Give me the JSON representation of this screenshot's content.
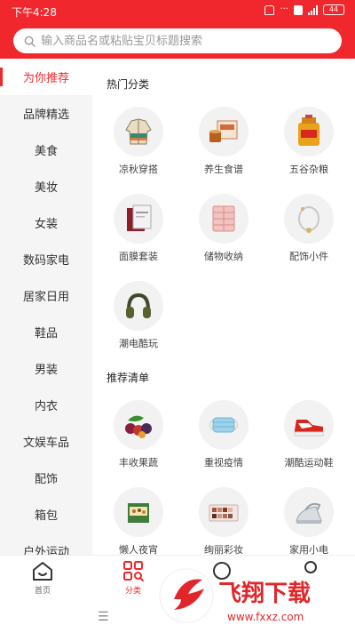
{
  "status_bar": {
    "time": "下午4:28",
    "battery": "44"
  },
  "search": {
    "placeholder": "输入商品名或粘贴宝贝标题搜索"
  },
  "sidebar": {
    "items": [
      {
        "label": "为你推荐",
        "active": true
      },
      {
        "label": "品牌精选"
      },
      {
        "label": "美食"
      },
      {
        "label": "美妆"
      },
      {
        "label": "女装"
      },
      {
        "label": "数码家电"
      },
      {
        "label": "居家日用"
      },
      {
        "label": "鞋品"
      },
      {
        "label": "男装"
      },
      {
        "label": "内衣"
      },
      {
        "label": "文娱车品"
      },
      {
        "label": "配饰"
      },
      {
        "label": "箱包"
      },
      {
        "label": "户外运动"
      }
    ]
  },
  "sections": [
    {
      "title": "热门分类",
      "items": [
        {
          "label": "凉秋穿搭",
          "icon": "jacket-icon"
        },
        {
          "label": "养生食谱",
          "icon": "health-food-icon"
        },
        {
          "label": "五谷杂粮",
          "icon": "grain-oil-icon"
        },
        {
          "label": "面膜套装",
          "icon": "face-mask-box-icon"
        },
        {
          "label": "储物收纳",
          "icon": "storage-drawer-icon"
        },
        {
          "label": "配饰小件",
          "icon": "bracelet-icon"
        },
        {
          "label": "潮电酷玩",
          "icon": "headphones-icon"
        }
      ]
    },
    {
      "title": "推荐清单",
      "items": [
        {
          "label": "丰收果蔬",
          "icon": "fruit-icon"
        },
        {
          "label": "重视疫情",
          "icon": "medical-mask-icon"
        },
        {
          "label": "潮酷运动鞋",
          "icon": "sneaker-icon"
        },
        {
          "label": "懒人夜宵",
          "icon": "snack-box-icon"
        },
        {
          "label": "绚丽彩妆",
          "icon": "eyeshadow-palette-icon"
        },
        {
          "label": "家用小电",
          "icon": "iron-icon"
        }
      ]
    }
  ],
  "bottom_nav": [
    {
      "label": "首页",
      "icon": "home-icon"
    },
    {
      "label": "分类",
      "icon": "category-icon",
      "active": true
    },
    {
      "label": "",
      "icon": "nav-icon-3"
    },
    {
      "label": "",
      "icon": "nav-icon-4"
    }
  ],
  "watermark": {
    "text": "飞翔下载",
    "url_text": "www.fxxz.com"
  },
  "colors": {
    "accent": "#f0282d",
    "sidebar_bg": "#f5f5f5"
  }
}
